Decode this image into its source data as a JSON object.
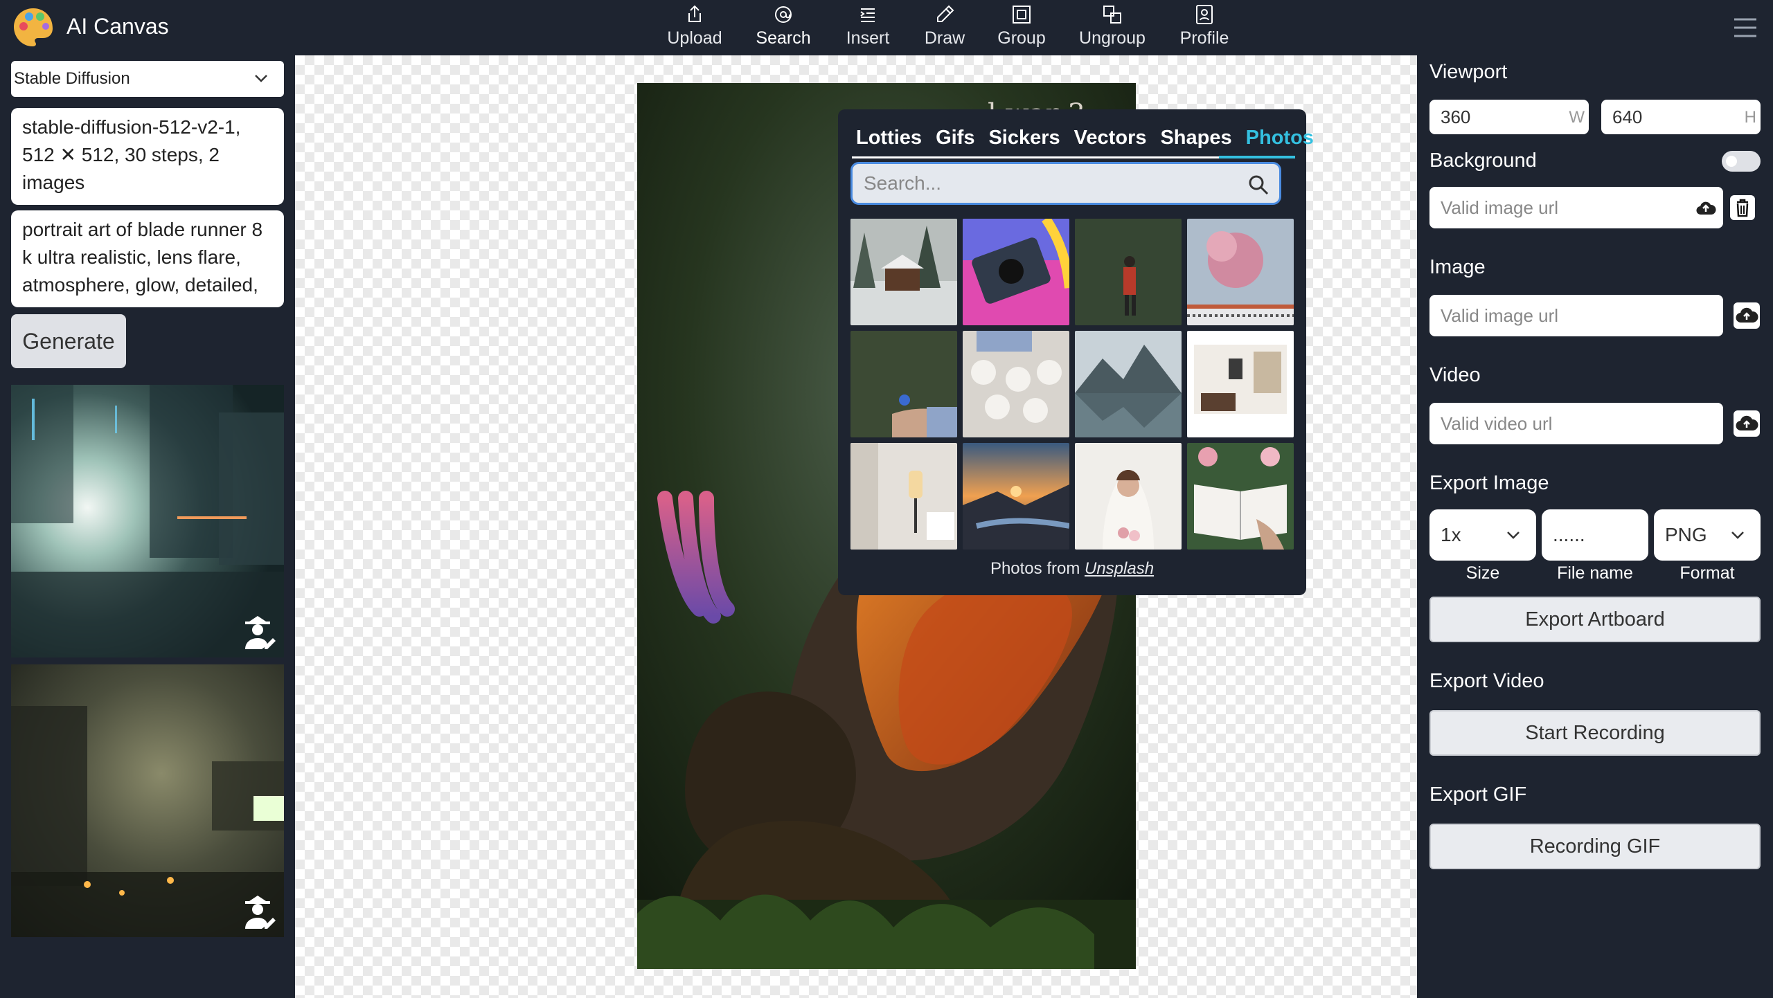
{
  "app": {
    "title": "AI Canvas"
  },
  "nav": {
    "items": [
      {
        "label": "Upload",
        "icon": "upload-icon"
      },
      {
        "label": "Search",
        "icon": "search-icon"
      },
      {
        "label": "Insert",
        "icon": "insert-icon"
      },
      {
        "label": "Draw",
        "icon": "pencil-icon"
      },
      {
        "label": "Group",
        "icon": "group-icon"
      },
      {
        "label": "Ungroup",
        "icon": "ungroup-icon"
      },
      {
        "label": "Profile",
        "icon": "profile-icon"
      }
    ],
    "active": "Search"
  },
  "left_panel": {
    "model_select": "Stable Diffusion",
    "settings_text": "stable-diffusion-512-v2-1, 512 ✕ 512, 30 steps, 2 images",
    "prompt_text": "portrait art of blade runner 8 k ultra realistic, lens flare, atmosphere, glow, detailed,",
    "generate_label": "Generate"
  },
  "canvas": {
    "artboard_text": "l war 3"
  },
  "search_popup": {
    "tabs": [
      "Lotties",
      "Gifs",
      "Sickers",
      "Vectors",
      "Shapes",
      "Photos"
    ],
    "active_tab": "Photos",
    "search_placeholder": "Search...",
    "credit_prefix": "Photos from",
    "credit_link": "Unsplash"
  },
  "right_panel": {
    "viewport_label": "Viewport",
    "width_value": "360",
    "width_suffix": "W",
    "height_value": "640",
    "height_suffix": "H",
    "background_label": "Background",
    "background_placeholder": "Valid image url",
    "image_label": "Image",
    "image_placeholder": "Valid image url",
    "video_label": "Video",
    "video_placeholder": "Valid video url",
    "export_image_label": "Export Image",
    "size_value": "1x",
    "filename_placeholder": "......",
    "format_value": "PNG",
    "size_caption": "Size",
    "filename_caption": "File name",
    "format_caption": "Format",
    "export_artboard_label": "Export Artboard",
    "export_video_label": "Export Video",
    "start_recording_label": "Start Recording",
    "export_gif_label": "Export GIF",
    "recording_gif_label": "Recording GIF"
  },
  "colors": {
    "accent": "#34c0e0",
    "panel": "#1e2430",
    "focus": "#4a8be0"
  }
}
